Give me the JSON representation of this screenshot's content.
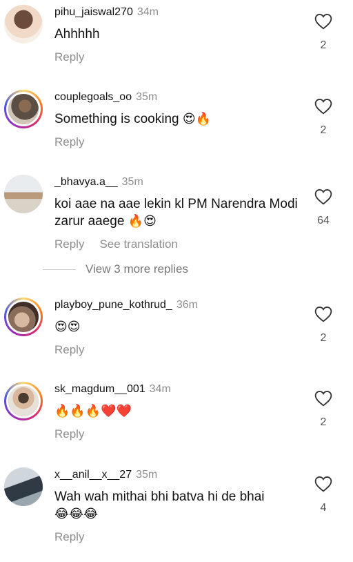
{
  "comments": [
    {
      "username": "pihu_jaiswal270",
      "time": "34m",
      "text": "Ahhhhh",
      "emoji": "",
      "reply_label": "Reply",
      "likes": "2",
      "translate_label": ""
    },
    {
      "username": "couplegoals_oo",
      "time": "35m",
      "text": "Something is cooking",
      "emoji": "😍🔥",
      "reply_label": "Reply",
      "likes": "2",
      "translate_label": ""
    },
    {
      "username": "_bhavya.a__",
      "time": "35m",
      "text": "koi aae na aae lekin kl PM Narendra Modi zarur aaege",
      "emoji": "🔥😍",
      "reply_label": "Reply",
      "likes": "64",
      "translate_label": "See translation"
    },
    {
      "username": "playboy_pune_kothrud_",
      "time": "36m",
      "text": "",
      "emoji": "😍😍",
      "reply_label": "Reply",
      "likes": "2",
      "translate_label": ""
    },
    {
      "username": "sk_magdum__001",
      "time": "34m",
      "text": "",
      "emoji": "🔥🔥🔥❤️❤️",
      "reply_label": "Reply",
      "likes": "2",
      "translate_label": ""
    },
    {
      "username": "x__anil__x__27",
      "time": "35m",
      "text": "Wah wah mithai bhi batva hi de bhai",
      "emoji": "😂😂😂",
      "reply_label": "Reply",
      "likes": "4",
      "translate_label": ""
    }
  ],
  "view_more_replies": "View 3 more replies",
  "icons": {
    "like": "heart-outline-icon"
  },
  "colors": {
    "muted": "#8e8e8e",
    "text": "#111111",
    "ring_start": "#feda75",
    "ring_end": "#d62976"
  }
}
